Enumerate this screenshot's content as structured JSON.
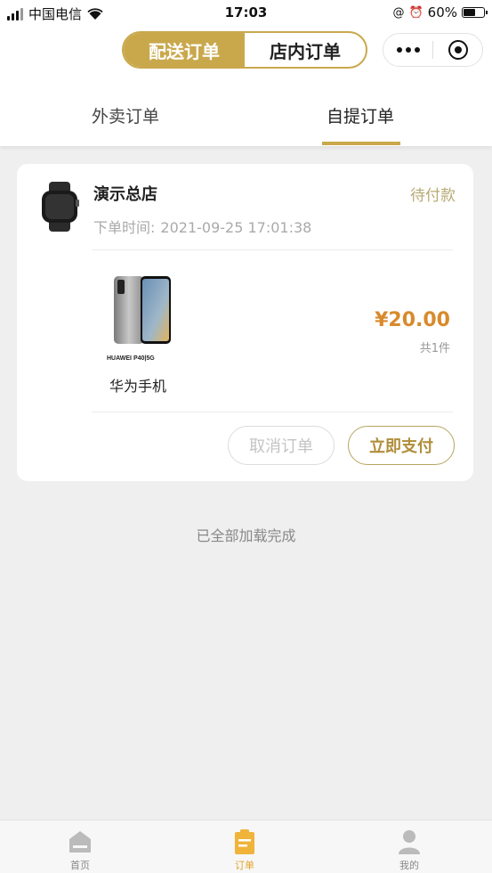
{
  "status_bar": {
    "carrier": "中国电信",
    "time": "17:03",
    "battery_percent": "60%",
    "battery_level": 0.6
  },
  "header": {
    "segment_active": "配送订单",
    "segment_inactive": "店内订单",
    "more_icon": "more-dots-icon",
    "close_icon": "target-close-icon"
  },
  "tabs": {
    "items": [
      {
        "label": "外卖订单"
      },
      {
        "label": "自提订单"
      }
    ],
    "active_index": 1
  },
  "order": {
    "shop_name": "演示总店",
    "status": "待付款",
    "time_label": "下单时间:",
    "time_value": "2021-09-25 17:01:38",
    "product_name": "华为手机",
    "product_image_caption": "HUAWEI P40|5G",
    "price": "¥20.00",
    "quantity": "共1件",
    "cancel_label": "取消订单",
    "pay_label": "立即支付"
  },
  "loaded_hint": "已全部加载完成",
  "tabbar": {
    "items": [
      {
        "label": "首页",
        "icon": "home-icon"
      },
      {
        "label": "订单",
        "icon": "order-clipboard-icon"
      },
      {
        "label": "我的",
        "icon": "person-icon"
      }
    ],
    "active_index": 1
  },
  "colors": {
    "accent_gold": "#c9a84c",
    "price_orange": "#d88a2c",
    "tab_active_yellow": "#e2a42a"
  }
}
